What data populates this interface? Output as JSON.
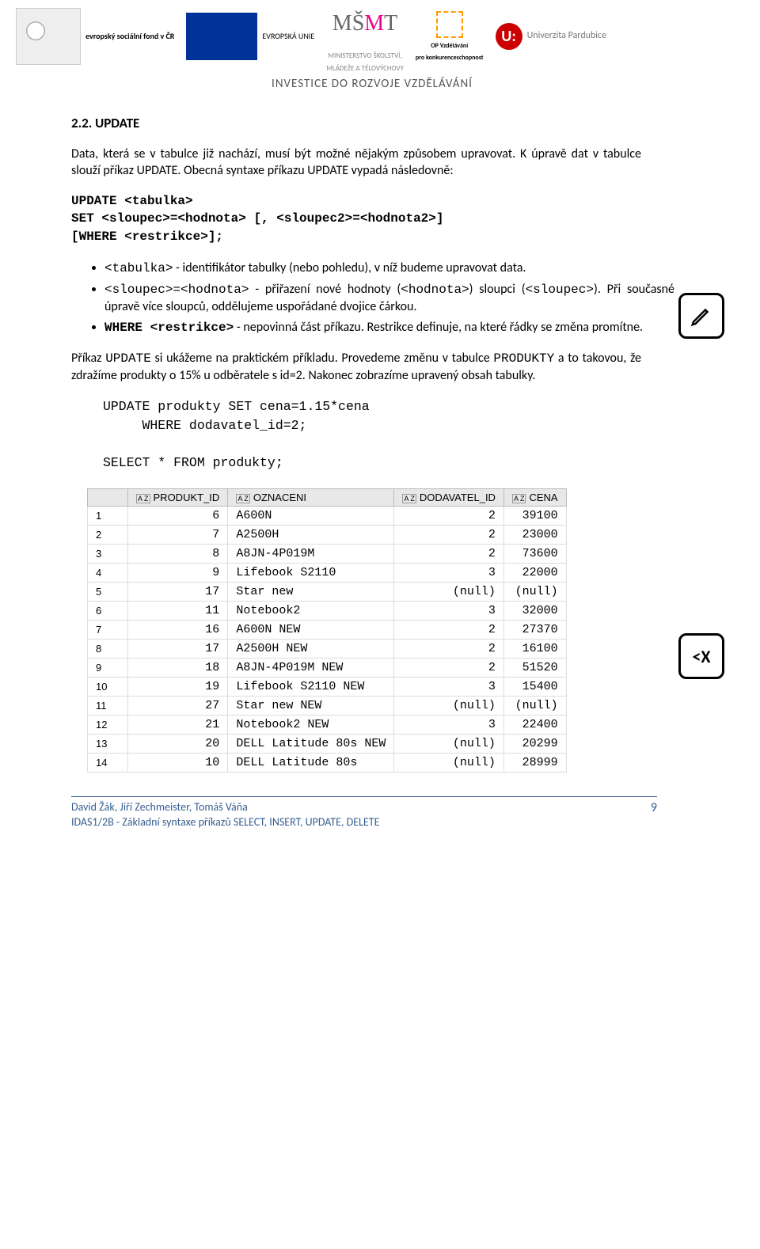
{
  "header": {
    "logos": {
      "esf": "evropský sociální fond v ČR",
      "eu": "EVROPSKÁ UNIE",
      "msmt_top": "MINISTERSTVO ŠKOLSTVÍ,",
      "msmt_bot": "MLÁDEŽE A TĚLOVÝCHOVY",
      "op_top": "OP Vzdělávání",
      "op_bot": "pro konkurenceschopnost",
      "univerzita": "Univerzita Pardubice"
    },
    "tagline": "INVESTICE DO ROZVOJE VZDĚLÁVÁNÍ"
  },
  "section": {
    "title": "2.2. UPDATE",
    "intro": "Data, která se v tabulce již nachází, musí být možné nějakým způsobem upravovat. K úpravě dat v tabulce slouží příkaz UPDATE. Obecná syntaxe příkazu UPDATE vypadá následovně:",
    "syntax": "UPDATE <tabulka>\nSET <sloupec>=<hodnota> [, <sloupec2>=<hodnota2>]\n[WHERE <restrikce>];",
    "bullets": {
      "b1_pre": "<tabulka>",
      "b1": " - identifikátor tabulky (nebo pohledu), v níž budeme upravovat data.",
      "b2_pre": "<sloupec>=<hodnota>",
      "b2_mid": " - přiřazení nové hodnoty (",
      "b2_h": "<hodnota>",
      "b2_mid2": ") sloupci (",
      "b2_s": "<sloupec>",
      "b2_end": "). Při současné úpravě více sloupců, oddělujeme uspořádané dvojice čárkou.",
      "b3_pre": "WHERE <restrikce>",
      "b3": " - nepovinná část příkazu. Restrikce definuje, na které řádky se změna promítne."
    },
    "para2_a": "Příkaz ",
    "para2_code": "UPDATE",
    "para2_b": " si ukážeme na praktickém příkladu. Provedeme změnu v tabulce ",
    "para2_code2": "PRODUKTY",
    "para2_c": " a to takovou, že zdražíme produkty o 15% u odběratele s id=2. Nakonec zobrazíme upravený obsah tabulky.",
    "sql": "UPDATE produkty SET cena=1.15*cena\n     WHERE dodavatel_id=2;\n\nSELECT * FROM produkty;"
  },
  "icons": {
    "pencil_label": "pencil-icon",
    "cx_text": "<X"
  },
  "table": {
    "headers": [
      "",
      "PRODUKT_ID",
      "OZNACENI",
      "DODAVATEL_ID",
      "CENA"
    ],
    "rows": [
      {
        "n": "1",
        "pid": "6",
        "oz": "A600N",
        "did": "2",
        "cena": "39100"
      },
      {
        "n": "2",
        "pid": "7",
        "oz": "A2500H",
        "did": "2",
        "cena": "23000"
      },
      {
        "n": "3",
        "pid": "8",
        "oz": "A8JN-4P019M",
        "did": "2",
        "cena": "73600"
      },
      {
        "n": "4",
        "pid": "9",
        "oz": "Lifebook S2110",
        "did": "3",
        "cena": "22000"
      },
      {
        "n": "5",
        "pid": "17",
        "oz": "Star new",
        "did": "(null)",
        "cena": "(null)"
      },
      {
        "n": "6",
        "pid": "11",
        "oz": "Notebook2",
        "did": "3",
        "cena": "32000"
      },
      {
        "n": "7",
        "pid": "16",
        "oz": "A600N NEW",
        "did": "2",
        "cena": "27370"
      },
      {
        "n": "8",
        "pid": "17",
        "oz": "A2500H NEW",
        "did": "2",
        "cena": "16100"
      },
      {
        "n": "9",
        "pid": "18",
        "oz": "A8JN-4P019M NEW",
        "did": "2",
        "cena": "51520"
      },
      {
        "n": "10",
        "pid": "19",
        "oz": "Lifebook S2110 NEW",
        "did": "3",
        "cena": "15400"
      },
      {
        "n": "11",
        "pid": "27",
        "oz": "Star new NEW",
        "did": "(null)",
        "cena": "(null)"
      },
      {
        "n": "12",
        "pid": "21",
        "oz": "Notebook2 NEW",
        "did": "3",
        "cena": "22400"
      },
      {
        "n": "13",
        "pid": "20",
        "oz": "DELL Latitude 80s NEW",
        "did": "(null)",
        "cena": "20299"
      },
      {
        "n": "14",
        "pid": "10",
        "oz": "DELL Latitude 80s",
        "did": "(null)",
        "cena": "28999"
      }
    ]
  },
  "footer": {
    "authors": "David Žák, Jiří Zechmeister, Tomáš Váňa",
    "course": "IDAS1/2B - Základní syntaxe příkazů SELECT, INSERT, UPDATE, DELETE",
    "page": "9"
  }
}
